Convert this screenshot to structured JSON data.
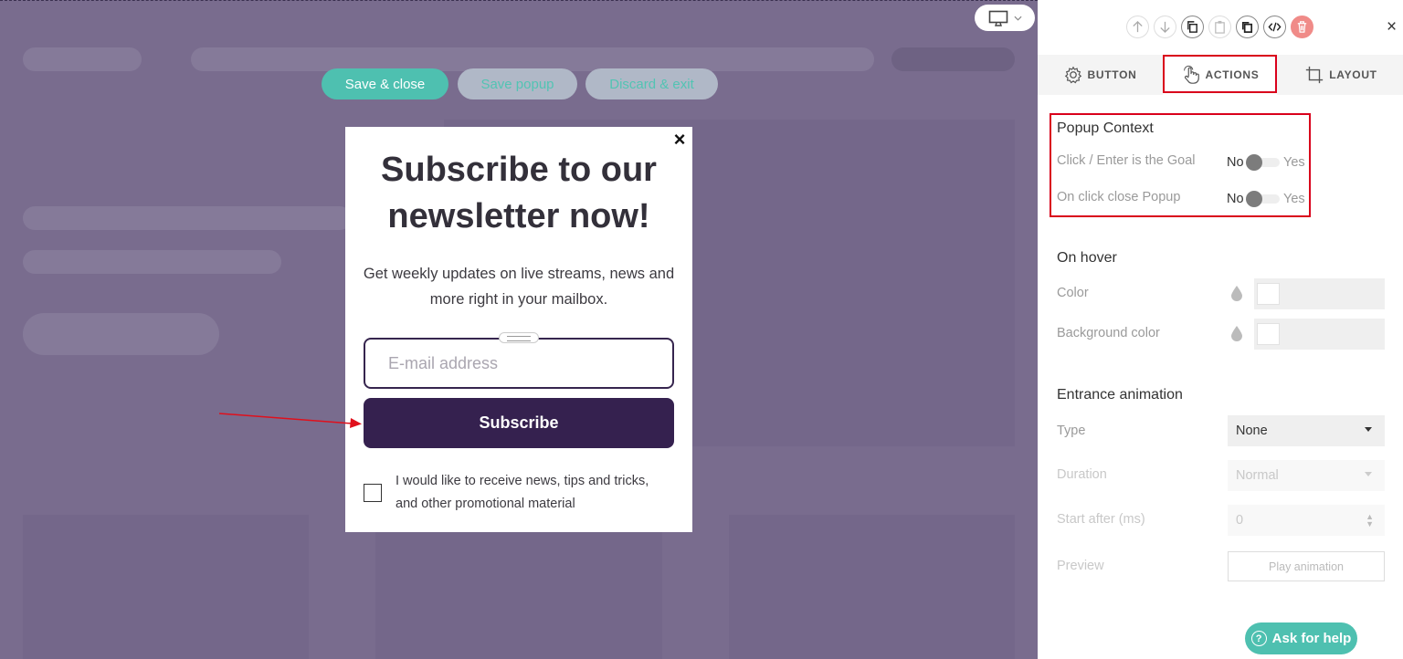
{
  "toolbar": {
    "save_close": "Save & close",
    "save_popup": "Save popup",
    "discard_exit": "Discard & exit"
  },
  "device_icon": "desktop-icon",
  "popup": {
    "close_glyph": "×",
    "title": "Subscribe to our newsletter now!",
    "subtitle": "Get weekly updates on live streams, news and more right in your mailbox.",
    "email_placeholder": "E-mail address",
    "subscribe_label": "Subscribe",
    "checkbox_label": "I would like to receive news, tips and tricks, and other promotional material"
  },
  "panel": {
    "close_glyph": "×",
    "icons": [
      "arrow-up-icon",
      "arrow-down-icon",
      "copy-icon",
      "paste-icon",
      "duplicate-icon",
      "code-icon",
      "trash-icon"
    ],
    "tabs": {
      "button": "BUTTON",
      "actions": "ACTIONS",
      "layout": "LAYOUT"
    },
    "popup_context": {
      "title": "Popup Context",
      "click_goal_label": "Click / Enter is the Goal",
      "close_popup_label": "On click close Popup",
      "no": "No",
      "yes": "Yes"
    },
    "hover": {
      "title": "On hover",
      "color_label": "Color",
      "bg_color_label": "Background color"
    },
    "animation": {
      "title": "Entrance animation",
      "type_label": "Type",
      "type_value": "None",
      "duration_label": "Duration",
      "duration_value": "Normal",
      "start_label": "Start after (ms)",
      "start_value": "0",
      "preview_label": "Preview",
      "play_label": "Play animation"
    },
    "help": "Ask for help"
  },
  "colors": {
    "accent": "#4ec0b0",
    "canvas_bg": "#796c8e",
    "subscribe_bg": "#35214f",
    "highlight": "#d9001b"
  }
}
